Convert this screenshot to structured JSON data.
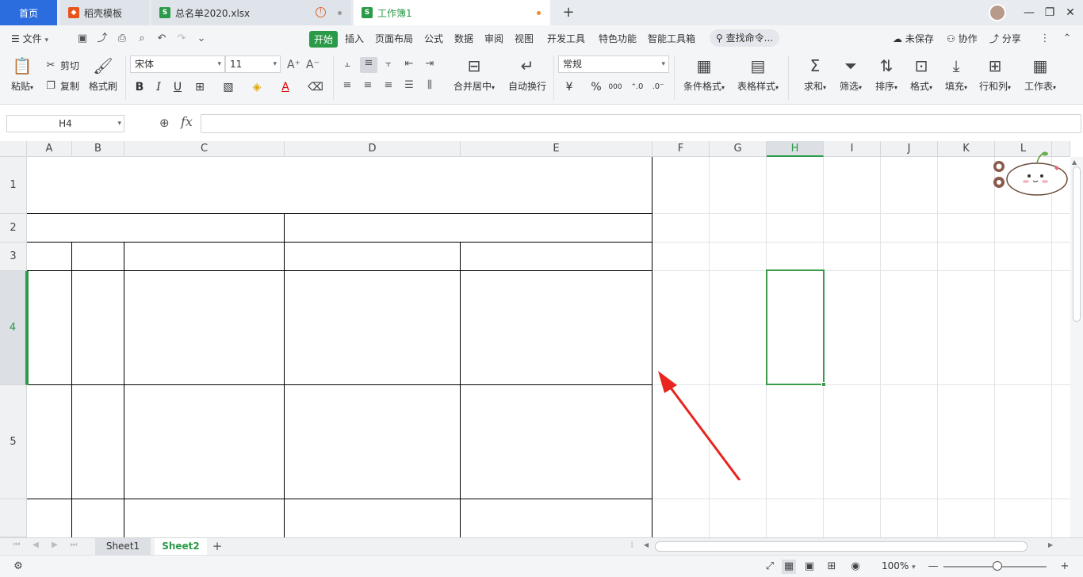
{
  "tabs": {
    "home": "首页",
    "daoke": "稻壳模板",
    "file1": "总名单2020.xlsx",
    "file2": "工作簿1",
    "file_badge": "S"
  },
  "menu": {
    "file": "文件",
    "items": [
      "开始",
      "插入",
      "页面布局",
      "公式",
      "数据",
      "审阅",
      "视图",
      "开发工具",
      "特色功能",
      "智能工具箱"
    ],
    "search": "查找命令...",
    "unsaved": "未保存",
    "collab": "协作",
    "share": "分享"
  },
  "ribbon": {
    "paste": "粘贴",
    "cut": "剪切",
    "copy": "复制",
    "format_painter": "格式刷",
    "font_name": "宋体",
    "font_size": "11",
    "merge_center": "合并居中",
    "auto_wrap": "自动换行",
    "number_format": "常规",
    "cond_format": "条件格式",
    "table_style": "表格样式",
    "sum": "求和",
    "filter": "筛选",
    "sort": "排序",
    "format": "格式",
    "fill": "填充",
    "row_col": "行和列",
    "worksheet": "工作表",
    "bold": "B",
    "italic": "I",
    "underline": "U",
    "font_color": "A",
    "currency": "¥",
    "percent": "%",
    "thousands": "000"
  },
  "formula_bar": {
    "name_box": "H4",
    "fx": "fx",
    "content": ""
  },
  "grid": {
    "columns": [
      "A",
      "B",
      "C",
      "D",
      "E",
      "F",
      "G",
      "H",
      "I",
      "J",
      "K",
      "L"
    ],
    "rows": [
      "1",
      "2",
      "3",
      "4",
      "5"
    ],
    "selected_column": "H",
    "selected_row": "4"
  },
  "sheets": {
    "tabs": [
      "Sheet1",
      "Sheet2"
    ],
    "active": "Sheet2",
    "add": "+"
  },
  "status": {
    "zoom": "100%"
  },
  "colors": {
    "accent": "#2a9a48",
    "home_tab": "#2b6cde",
    "arrow": "#e8251f"
  }
}
